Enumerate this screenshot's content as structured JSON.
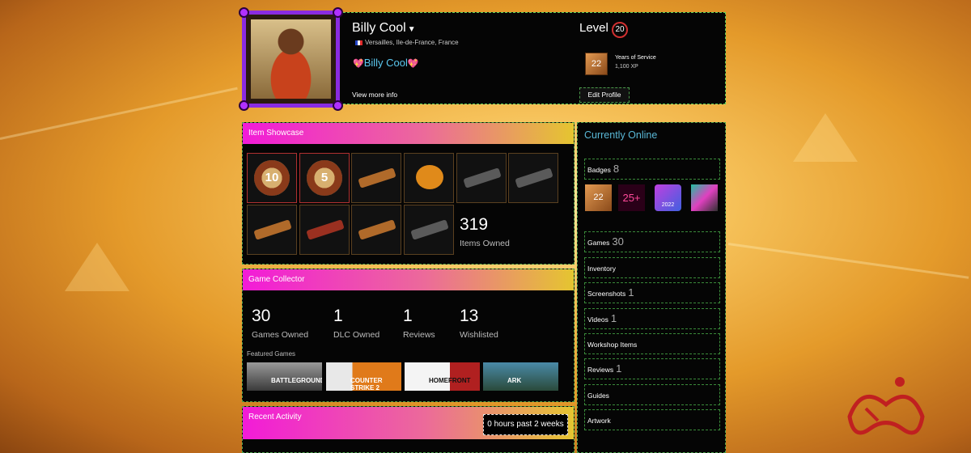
{
  "profile": {
    "persona_name": "Billy Cool",
    "location": "Versailles, Ile-de-France, France",
    "nickname": "Billy Cool",
    "view_more": "View more info",
    "level_label": "Level",
    "level": "20",
    "years_badge_value": "22",
    "years_title": "Years of Service",
    "years_xp": "1,100 XP",
    "edit_profile": "Edit Profile"
  },
  "item_showcase": {
    "title": "Item Showcase",
    "items": [
      {
        "icon": "ten-year-coin-icon",
        "label": "10"
      },
      {
        "icon": "five-year-coin-icon",
        "label": "5"
      },
      {
        "icon": "rocket-launcher-icon"
      },
      {
        "icon": "pumpkin-icon"
      },
      {
        "icon": "launcher-icon"
      },
      {
        "icon": "grenade-launcher-icon"
      },
      {
        "icon": "orange-rifle-icon"
      },
      {
        "icon": "red-blaster-icon"
      },
      {
        "icon": "rocket-launcher-icon"
      },
      {
        "icon": "bazooka-icon"
      }
    ],
    "count": "319",
    "count_label": "Items Owned"
  },
  "game_collector": {
    "title": "Game Collector",
    "stats": [
      {
        "value": "30",
        "label": "Games Owned"
      },
      {
        "value": "1",
        "label": "DLC Owned"
      },
      {
        "value": "1",
        "label": "Reviews"
      },
      {
        "value": "13",
        "label": "Wishlisted"
      }
    ],
    "featured_label": "Featured Games",
    "featured": [
      {
        "name": "PUBG BATTLEGROUNDS",
        "text": "BATTLEGROUNDS",
        "color": "#6a6a6a"
      },
      {
        "name": "COUNTER STRIKE 2",
        "text": "COUNTER STRIKE 2",
        "color": "#e07a1a"
      },
      {
        "name": "HOMEFRONT",
        "text": "HOMEFRONT",
        "color": "#ffffff"
      },
      {
        "name": "ARK",
        "text": "ARK",
        "color": "#3a7a9a"
      }
    ]
  },
  "recent_activity": {
    "title": "Recent Activity",
    "hours": "0 hours past 2 weeks"
  },
  "sidebar": {
    "status": "Currently Online",
    "badges_label": "Badges",
    "badges_count": "8",
    "badges": [
      {
        "icon": "years-of-service-badge-icon",
        "text": "22"
      },
      {
        "icon": "level-25-badge-icon",
        "text": "25+"
      },
      {
        "icon": "steam-2022-badge-icon",
        "text": "2022"
      },
      {
        "icon": "pixel-art-badge-icon",
        "text": ""
      }
    ],
    "links": [
      {
        "label": "Games",
        "count": "30"
      },
      {
        "label": "Inventory",
        "count": ""
      },
      {
        "label": "Screenshots",
        "count": "1"
      },
      {
        "label": "Videos",
        "count": "1"
      },
      {
        "label": "Workshop Items",
        "count": ""
      },
      {
        "label": "Reviews",
        "count": "1"
      },
      {
        "label": "Guides",
        "count": ""
      },
      {
        "label": "Artwork",
        "count": ""
      }
    ]
  },
  "colors": {
    "accent_blue": "#59b7d6",
    "header_gradient_start": "#f21bd8",
    "header_gradient_end": "#e5c530",
    "frame_purple": "#8a2be2"
  }
}
